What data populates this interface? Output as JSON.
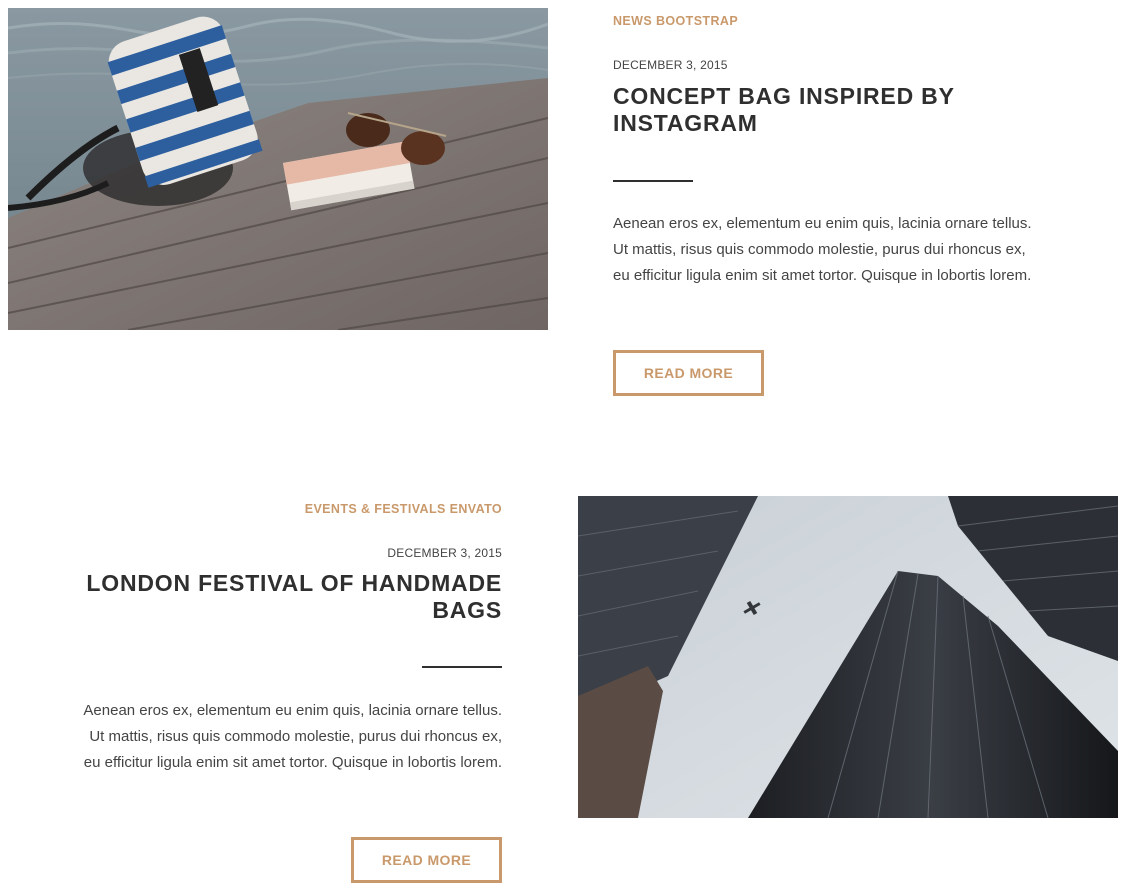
{
  "theme": {
    "accent": "#c9996b",
    "heading": "#2f2f2f",
    "body_text": "#444444"
  },
  "posts": [
    {
      "categories": [
        "News",
        "Bootstrap"
      ],
      "date": "DECEMBER 3, 2015",
      "title": "Concept bag inspired by Instagram",
      "excerpt": "Aenean eros ex, elementum eu enim quis, lacinia ornare tellus. Ut mattis, risus quis commodo molestie, purus dui rhoncus ex, eu efficitur ligula enim sit amet tortor. Quisque in lobortis lorem.",
      "button_label": "Read More",
      "image": "bag-on-dock-photo"
    },
    {
      "categories": [
        "Events & Festivals",
        "Envato"
      ],
      "date": "DECEMBER 3, 2015",
      "title": "London festival of handmade bags",
      "excerpt": "Aenean eros ex, elementum eu enim quis, lacinia ornare tellus. Ut mattis, risus quis commodo molestie, purus dui rhoncus ex, eu efficitur ligula enim sit amet tortor. Quisque in lobortis lorem.",
      "button_label": "Read More",
      "image": "skyscrapers-photo"
    }
  ]
}
